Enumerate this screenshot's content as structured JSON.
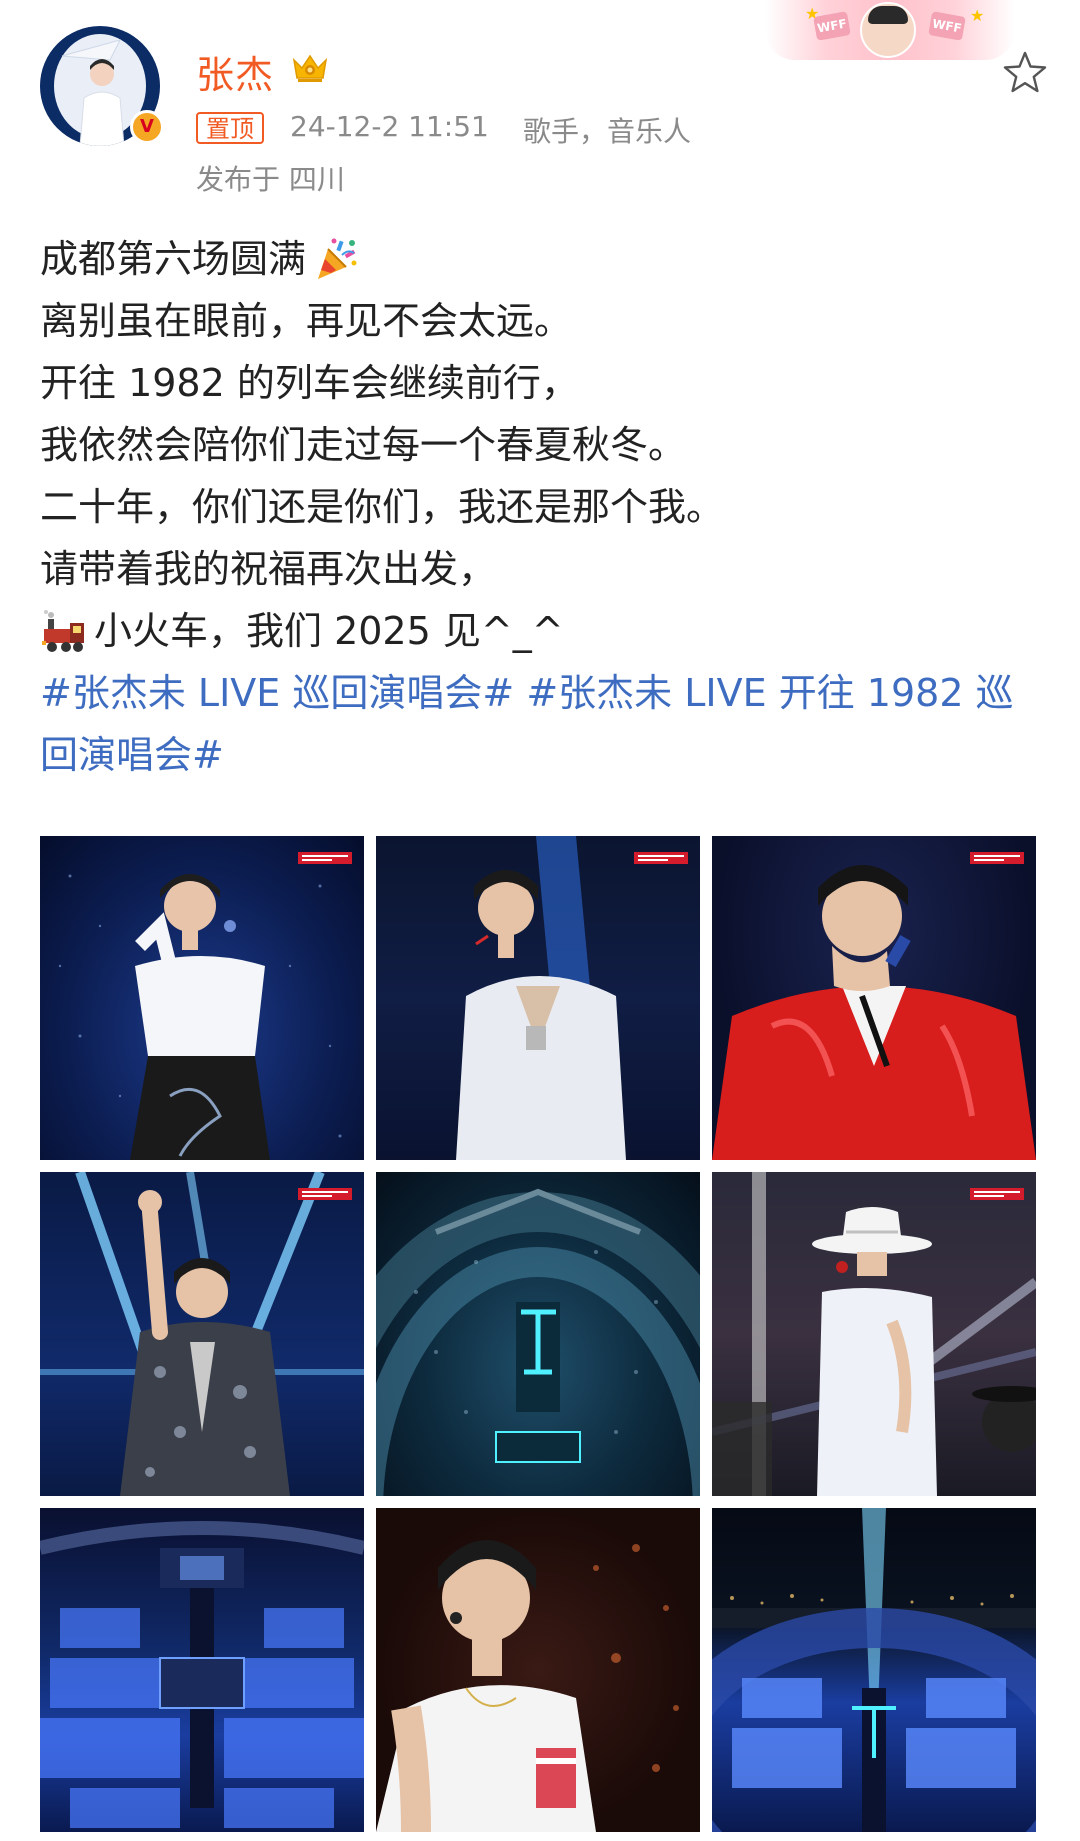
{
  "post": {
    "author": {
      "name": "张杰",
      "verified_badge": "V"
    },
    "meta": {
      "pin_label": "置顶",
      "time": "24-12-2 11:51",
      "tags": "歌手，音乐人",
      "location": "发布于 四川"
    },
    "banner": {
      "tag_text": "WFF"
    },
    "icons": {
      "avatar": "avatar-image",
      "verified": "verified-badge-icon",
      "crown": "crown-icon",
      "star": "star-icon",
      "party_popper": "party-popper-icon",
      "train": "train-icon"
    },
    "text": {
      "line1": "成都第六场圆满",
      "line2": "离别虽在眼前，再见不会太远。",
      "line3": "开往 1982 的列车会继续前行，",
      "line4": "我依然会陪你们走过每一个春夏秋冬。",
      "line5": "二十年，你们还是你们，我还是那个我。",
      "line6": "请带着我的祝福再次出发，",
      "line7": "小火车，我们 2025 见^_^"
    },
    "hashtags": [
      "#张杰未 LIVE 巡回演唱会#",
      "#张杰未 LIVE 开往 1982 巡回演唱会#"
    ],
    "photos": [
      {
        "name": "concert-photo-1"
      },
      {
        "name": "concert-photo-2"
      },
      {
        "name": "concert-photo-3"
      },
      {
        "name": "concert-photo-4"
      },
      {
        "name": "concert-photo-5"
      },
      {
        "name": "concert-photo-6"
      },
      {
        "name": "concert-photo-7"
      },
      {
        "name": "concert-photo-8"
      },
      {
        "name": "concert-photo-9"
      }
    ],
    "colors": {
      "username": "#f25a23",
      "meta_gray": "#8a8a8a",
      "hashtag_blue": "#3d6cc0",
      "body_text": "#222222"
    }
  }
}
